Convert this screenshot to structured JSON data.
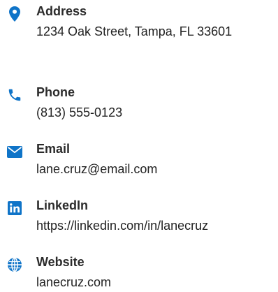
{
  "accent_color": "#0f74c8",
  "contacts": [
    {
      "icon": "map-pin-icon",
      "label": "Address",
      "value": "1234 Oak Street, Tampa, FL 33601"
    },
    {
      "icon": "phone-icon",
      "label": "Phone",
      "value": "(813) 555-0123"
    },
    {
      "icon": "envelope-icon",
      "label": "Email",
      "value": "lane.cruz@email.com"
    },
    {
      "icon": "linkedin-icon",
      "label": "LinkedIn",
      "value": "https://linkedin.com/in/lanecruz"
    },
    {
      "icon": "globe-icon",
      "label": "Website",
      "value": "lanecruz.com"
    }
  ]
}
